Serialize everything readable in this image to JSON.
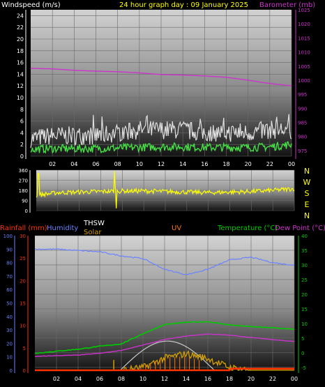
{
  "header": {
    "left_label": "Windspeed (m/s)",
    "center_label": "24 hour graph day : 09 January 2025",
    "right_label": "Barometer (mb)"
  },
  "colors": {
    "wind_left": "#ffffff",
    "title": "#ffff00",
    "barometer": "#cc33cc",
    "gust": "#e0e0e0",
    "average": "#44dd44",
    "direction": "#ffff00",
    "rain": "#ff3300",
    "humidity": "#6a82ff",
    "thsw": "#ffffff",
    "solar": "#d4a000",
    "uv": "#ff7700",
    "temperature": "#00cc00",
    "dewpoint": "#cc33cc",
    "clear_sky": "#c8c8c8"
  },
  "x_ticks": [
    "02",
    "04",
    "06",
    "08",
    "10",
    "12",
    "14",
    "16",
    "18",
    "20",
    "22",
    "00"
  ],
  "dir_labels": [
    "N",
    "W",
    "S",
    "E",
    "N"
  ],
  "bottom_legend": {
    "rainfall": "Rainfall (mm)",
    "humidity": "Humidity",
    "thsw": "THSW",
    "solar": "Solar",
    "uv": "UV",
    "temperature": "Temperature (°C)",
    "dewpoint": "Dew Point (°C)"
  },
  "chart_data": [
    {
      "type": "line",
      "title": "24 hour graph day : 09 January 2025",
      "x": [
        0,
        2,
        4,
        6,
        8,
        10,
        12,
        14,
        16,
        18,
        20,
        22,
        24
      ],
      "y_left_label": "Windspeed (m/s)",
      "y_left_ticks": [
        0,
        2,
        4,
        6,
        8,
        10,
        12,
        14,
        16,
        18,
        20,
        22,
        24
      ],
      "y_left_lim": [
        0,
        25
      ],
      "y_right_label": "Barometer (mb)",
      "y_right_ticks": [
        975,
        980,
        985,
        990,
        995,
        1000,
        1005,
        1010,
        1015,
        1020,
        1025
      ],
      "y_right_lim": [
        973,
        1025
      ],
      "series": [
        {
          "values": [
            3,
            3.5,
            3.5,
            3.5,
            4,
            4.5,
            4.5,
            4.5,
            4,
            4,
            4,
            4.5,
            4.5
          ]
        },
        {
          "values": [
            1.2,
            1.3,
            1.3,
            1.3,
            1.4,
            1.5,
            1.6,
            1.6,
            1.5,
            1.5,
            1.5,
            1.6,
            2
          ]
        },
        {
          "values": [
            1004.2,
            1004.0,
            1003.5,
            1003.2,
            1003.0,
            1002.6,
            1002.0,
            1001.8,
            1001.5,
            1001.0,
            1000.0,
            998.8,
            998.0
          ]
        }
      ]
    },
    {
      "type": "line",
      "x": [
        0,
        2,
        4,
        6,
        8,
        10,
        12,
        14,
        16,
        18,
        20,
        22,
        24
      ],
      "y_ticks": [
        0,
        90,
        180,
        270,
        360
      ],
      "y_lim": [
        0,
        360
      ],
      "series": [
        {
          "values": [
            135,
            160,
            165,
            170,
            175,
            175,
            170,
            165,
            160,
            165,
            170,
            180,
            195
          ]
        }
      ]
    },
    {
      "type": "line",
      "x": [
        0,
        2,
        4,
        6,
        8,
        10,
        12,
        14,
        16,
        18,
        20,
        22,
        24
      ],
      "y_left_ticks": [
        0,
        5,
        10,
        15,
        20,
        25,
        30
      ],
      "y_left_lim": [
        0,
        30
      ],
      "y_humidity_ticks": [
        0,
        10,
        20,
        30,
        40,
        50,
        60,
        70,
        80,
        90,
        100
      ],
      "y_humidity_lim": [
        0,
        100
      ],
      "y_right_ticks": [
        -5,
        0,
        5,
        10,
        15,
        20,
        25,
        30,
        35,
        40
      ],
      "y_right_lim": [
        -6,
        40
      ],
      "series": [
        {
          "values": [
            90,
            90,
            89,
            88,
            85,
            83,
            75,
            71,
            75,
            82,
            84,
            80,
            78
          ]
        },
        {
          "values": [
            -0.2,
            0.5,
            1.2,
            2.2,
            3.0,
            6.5,
            9.6,
            10.4,
            10.6,
            9.5,
            8.9,
            8.5,
            8.0
          ]
        },
        {
          "values": [
            -1.3,
            -1.0,
            -0.8,
            -0.2,
            0.8,
            2.6,
            4.5,
            5.7,
            6.4,
            6.0,
            5.2,
            4.5,
            3.8
          ]
        },
        {
          "values": [
            0,
            0,
            0,
            0,
            0,
            0.6,
            2.7,
            3.7,
            2.6,
            0.6,
            0,
            0,
            0
          ]
        },
        {
          "values": [
            0,
            0,
            0,
            0,
            0,
            0.4,
            1.3,
            1.4,
            0.8,
            0,
            0,
            0,
            0
          ]
        },
        {
          "values": [
            0,
            0,
            0,
            0,
            0,
            0,
            0,
            0,
            0,
            0,
            0.08,
            0.08,
            0.08
          ]
        }
      ]
    }
  ]
}
